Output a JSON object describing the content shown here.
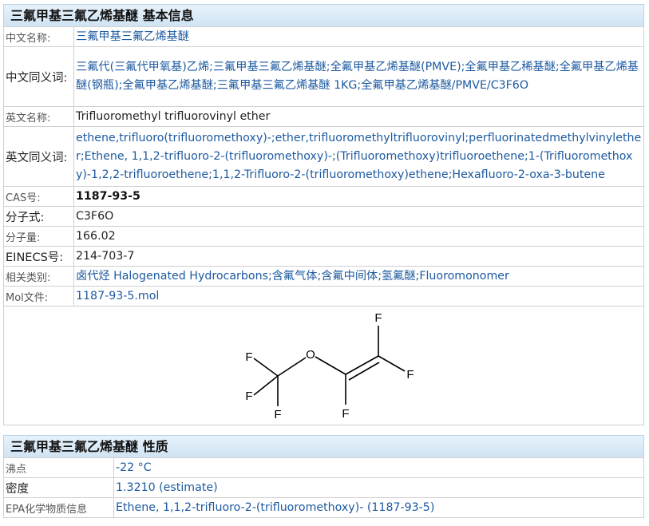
{
  "section1": {
    "title": "三氟甲基三氟乙烯基醚 基本信息",
    "rows": {
      "cn_name": {
        "label": "中文名称:",
        "value": "三氟甲基三氟乙烯基醚"
      },
      "cn_synonyms": {
        "label": "中文同义词:",
        "value": "三氟代(三氟代甲氧基)乙烯;三氟甲基三氟乙烯基醚;全氟甲基乙烯基醚(PMVE);全氟甲基乙稀基醚;全氟甲基乙烯基醚(钢瓶);全氟甲基乙烯基醚;三氟甲基三氟乙烯基醚 1KG;全氟甲基乙烯基醚/PMVE/C3F6O"
      },
      "en_name": {
        "label": "英文名称:",
        "value": "Trifluoromethyl trifluorovinyl ether"
      },
      "en_synonyms": {
        "label": "英文同义词:",
        "value": "ethene,trifluoro(trifluoromethoxy)-;ether,trifluoromethyltrifluorovinyl;perfluorinatedmethylvinylether;Ethene, 1,1,2-trifluoro-2-(trifluoromethoxy)-;(Trifluoromethoxy)trifluoroethene;1-(Trifluoromethoxy)-1,2,2-trifluoroethene;1,1,2-Trifluoro-2-(trifluoromethoxy)ethene;Hexafluoro-2-oxa-3-butene"
      },
      "cas": {
        "label": "CAS号:",
        "value": "1187-93-5"
      },
      "formula": {
        "label": "分子式:",
        "value": "C3F6O"
      },
      "mw": {
        "label": "分子量:",
        "value": "166.02"
      },
      "einecs": {
        "label": "EINECS号:",
        "value": "214-703-7"
      },
      "category": {
        "label": "相关类别:",
        "value": "卤代烃 Halogenated Hydrocarbons;含氟气体;含氟中间体;氢氟醚;Fluoromonomer"
      },
      "mol": {
        "label": "Mol文件:",
        "value": "1187-93-5.mol"
      }
    },
    "structure": {
      "atom_F": "F",
      "atom_O": "O"
    }
  },
  "section2": {
    "title": "三氟甲基三氟乙烯基醚 性质",
    "rows": {
      "bp": {
        "label": "沸点",
        "value": "-22 °C"
      },
      "density": {
        "label": "密度",
        "value": "1.3210 (estimate)"
      },
      "epa": {
        "label": "EPA化学物质信息",
        "value": "Ethene, 1,1,2-trifluoro-2-(trifluoromethoxy)- (1187-93-5)"
      }
    }
  },
  "colors": {
    "link": "#1d5aa0",
    "header_bg": "#d8e9f6",
    "border": "#cfcfcf"
  }
}
